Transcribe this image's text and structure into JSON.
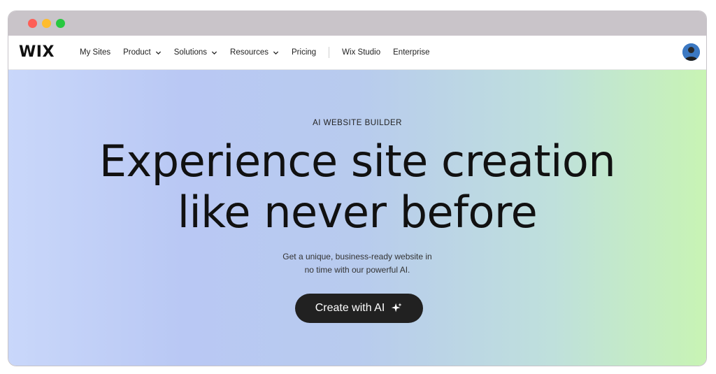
{
  "window": {
    "controls": [
      "close",
      "minimize",
      "maximize"
    ]
  },
  "nav": {
    "logo": "WIX",
    "items": [
      {
        "label": "My Sites",
        "has_dropdown": false
      },
      {
        "label": "Product",
        "has_dropdown": true
      },
      {
        "label": "Solutions",
        "has_dropdown": true
      },
      {
        "label": "Resources",
        "has_dropdown": true
      },
      {
        "label": "Pricing",
        "has_dropdown": false
      },
      {
        "label": "Wix Studio",
        "has_dropdown": false
      },
      {
        "label": "Enterprise",
        "has_dropdown": false
      }
    ]
  },
  "hero": {
    "eyebrow": "AI WEBSITE BUILDER",
    "headline_line1": "Experience site creation",
    "headline_line2": "like never before",
    "subtext_line1": "Get a unique, business-ready website in",
    "subtext_line2": "no time with our powerful AI.",
    "cta_label": "Create with AI"
  },
  "icons": {
    "cta_icon": "sparkle-icon",
    "dropdown_icon": "chevron-down-icon",
    "avatar": "user-avatar"
  },
  "colors": {
    "cta_bg": "#212121",
    "gradient_left": "#c9d7fa",
    "gradient_right": "#c8f4b4",
    "titlebar": "#c9c4c9"
  }
}
